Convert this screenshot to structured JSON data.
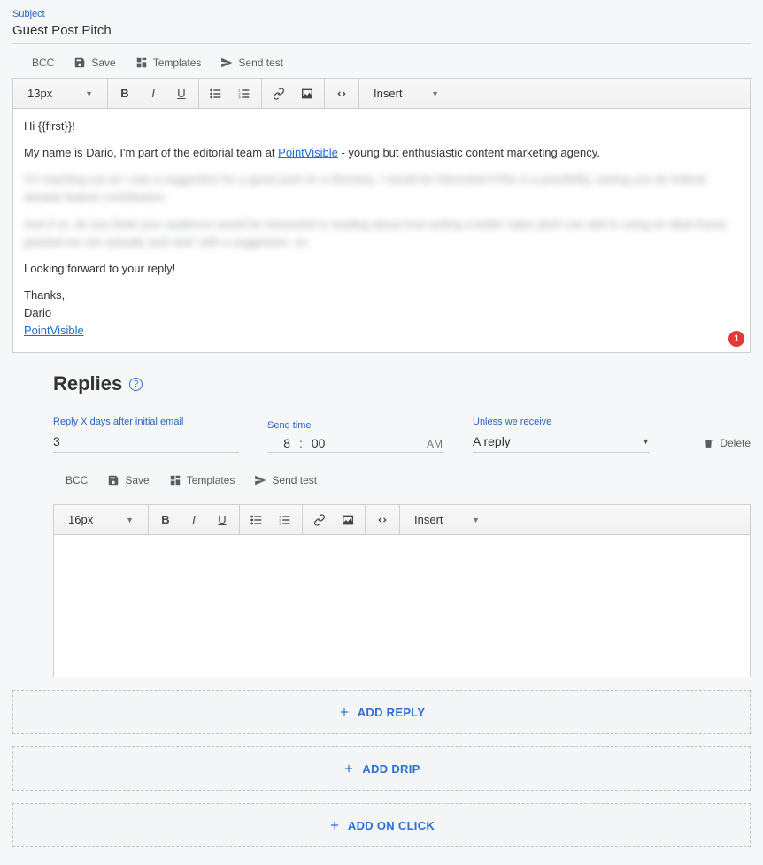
{
  "subject": {
    "label": "Subject",
    "value": "Guest Post Pitch"
  },
  "toolbar": {
    "bcc": "BCC",
    "save": "Save",
    "templates": "Templates",
    "send_test": "Send test"
  },
  "rte": {
    "font_size": "13px",
    "insert": "Insert"
  },
  "body": {
    "greeting": "Hi {{first}}!",
    "intro_before_link": "My name is Dario, I'm part of the editorial team at ",
    "intro_link_text": "PointVisible",
    "intro_after_link": " - young but enthusiastic content marketing agency.",
    "blurred_1": "I'm reaching out as I saw a suggestion for a guest post on a directory. I would be interested if this is a possibility, seeing you do indeed already feature contributors.",
    "blurred_2": "And if so, do you think your audience would be interested in reading about how writing a better sales pitch can add to using an ideal frame, granted we can actually 'pull rank' with a suggestion, so.",
    "closing": "Looking forward to your reply!",
    "thanks": "Thanks,",
    "sig_name": "Dario",
    "sig_link": "PointVisible"
  },
  "badge": {
    "count": "1"
  },
  "replies": {
    "title": "Replies",
    "days_label": "Reply X days after initial email",
    "days_value": "3",
    "time_label": "Send time",
    "time_hour": "8",
    "time_minute": "00",
    "time_ampm": "AM",
    "unless_label": "Unless we receive",
    "unless_value": "A reply",
    "delete": "Delete"
  },
  "rte2": {
    "font_size": "16px",
    "insert": "Insert"
  },
  "add": {
    "reply": "ADD REPLY",
    "drip": "ADD DRIP",
    "onclick": "ADD ON CLICK"
  }
}
